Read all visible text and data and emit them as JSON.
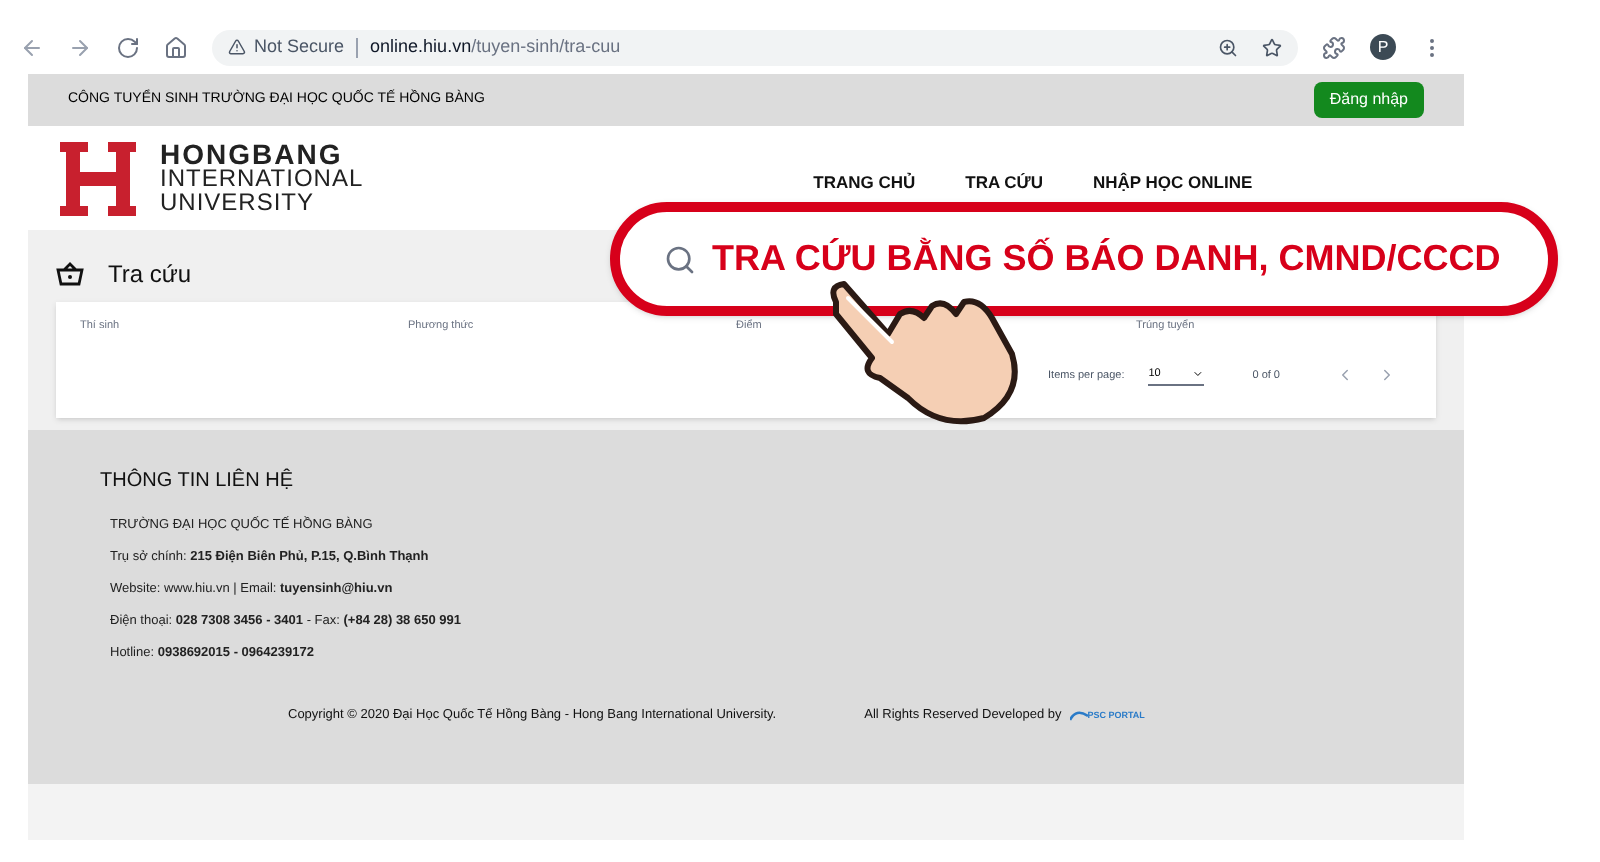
{
  "browser": {
    "security": "Not Secure",
    "url_host": "online.hiu.vn",
    "url_path": "/tuyen-sinh/tra-cuu",
    "profile_initial": "P"
  },
  "top_bar": {
    "title": "CÔNG TUYỂN SINH TRƯỜNG ĐẠI HỌC QUỐC TẾ HỒNG BÀNG",
    "login_button": "Đăng nhập"
  },
  "header": {
    "logo_name": "HONGBANG",
    "logo_line_2": "INTERNATIONAL",
    "logo_line_3": "UNIVERSITY",
    "nav": [
      {
        "label": "TRANG CHỦ"
      },
      {
        "label": "TRA CỨU"
      },
      {
        "label": "NHẬP HỌC ONLINE"
      }
    ]
  },
  "section": {
    "title": "Tra cứu",
    "table": {
      "columns": [
        "Thí sinh",
        "Phương thức",
        "Điểm",
        "Trúng tuyển"
      ]
    },
    "paginator": {
      "items_per_page_label": "Items per page:",
      "items_per_page": "10",
      "range": "0 of 0"
    }
  },
  "footer": {
    "title": "THÔNG TIN LIÊN HỆ",
    "lines": [
      "TRƯỜNG ĐẠI HỌC QUỐC TẾ HỒNG BÀNG",
      "Trụ sở chính: **215 Điện Biên Phủ, P.15, Q.Bình Thạnh**",
      "Website: www.hiu.vn | Email: **tuyensinh@hiu.vn**",
      "Điện thoại: **028 7308 3456 - 3401** - Fax: **(+84 28) 38 650 991**",
      "Hotline: **0938692015 - 0964239172**"
    ],
    "copyright": "Copyright © 2020 Đại Học Quốc Tế Hồng Bàng - Hong Bang International University.",
    "developed_by": "All Rights Reserved Developed by",
    "developer_logo": "PSC PORTAL"
  },
  "callout": {
    "text": "TRA CỨU BẰNG SỐ BÁO DANH, CMND/CCCD"
  }
}
